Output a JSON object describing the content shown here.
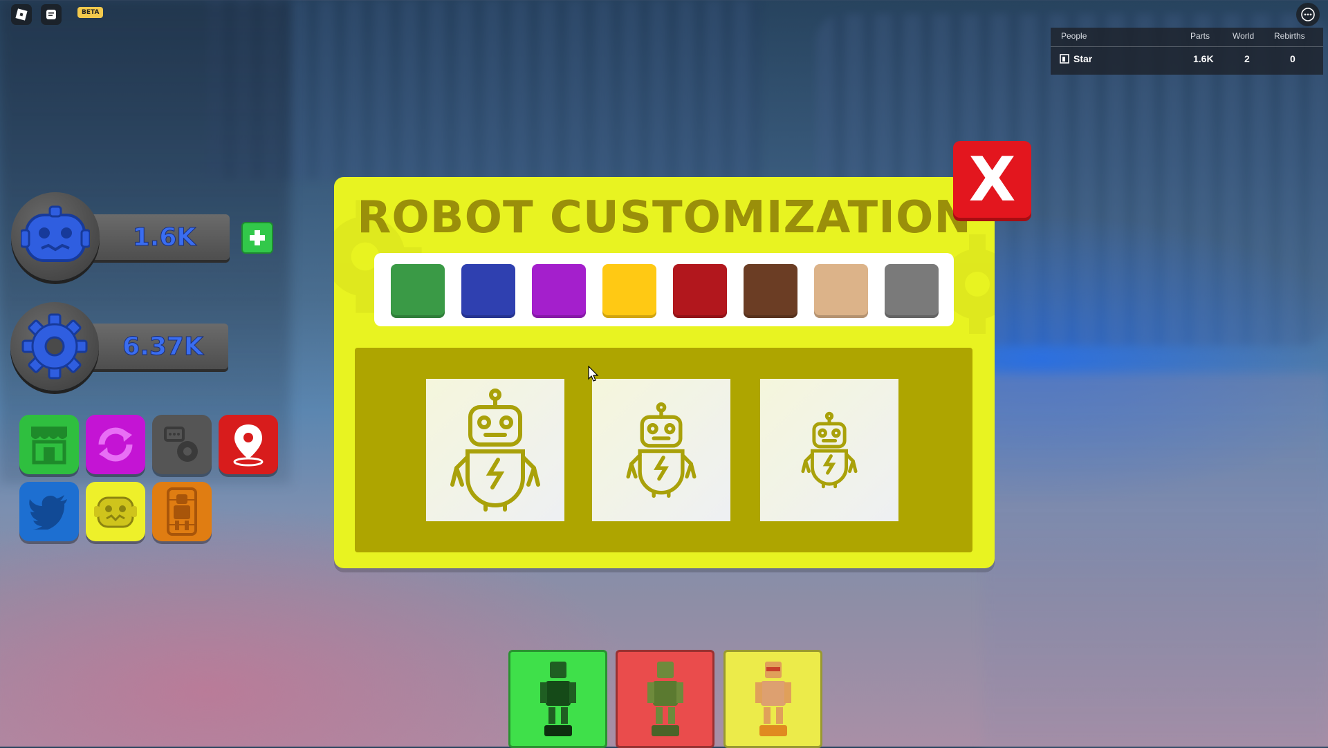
{
  "topbar": {
    "beta_label": "BETA"
  },
  "leaderboard": {
    "headers": {
      "people": "People",
      "parts": "Parts",
      "world": "World",
      "rebirths": "Rebirths"
    },
    "row": {
      "name": "Star",
      "parts": "1.6K",
      "world": "2",
      "rebirths": "0"
    }
  },
  "stats": {
    "robots_value": "1.6K",
    "gears_value": "6.37K"
  },
  "apps": [
    {
      "icon": "shop-icon",
      "color": "#2fbf3f"
    },
    {
      "icon": "rebirth-icon",
      "color": "#c414d4"
    },
    {
      "icon": "settings-icon",
      "color": "#555555"
    },
    {
      "icon": "teleport-icon",
      "color": "#d81c1c"
    },
    {
      "icon": "twitter-icon",
      "color": "#1d6fd1"
    },
    {
      "icon": "robot-face-icon",
      "color": "#eef02a"
    },
    {
      "icon": "robot-capsule-icon",
      "color": "#e07d12"
    }
  ],
  "panel": {
    "title": "ROBOT CUSTOMIZATION",
    "colors": [
      "#3a9a46",
      "#2f40b0",
      "#a41fcc",
      "#ffc914",
      "#b2171d",
      "#6b3d24",
      "#dcb389",
      "#7a7a7a"
    ],
    "robot_sizes": [
      "large",
      "medium",
      "small"
    ]
  },
  "close_label": "X",
  "hotbar": [
    {
      "color": "#3fe04a"
    },
    {
      "color": "#ea4c4c"
    },
    {
      "color": "#eceb4a"
    }
  ]
}
